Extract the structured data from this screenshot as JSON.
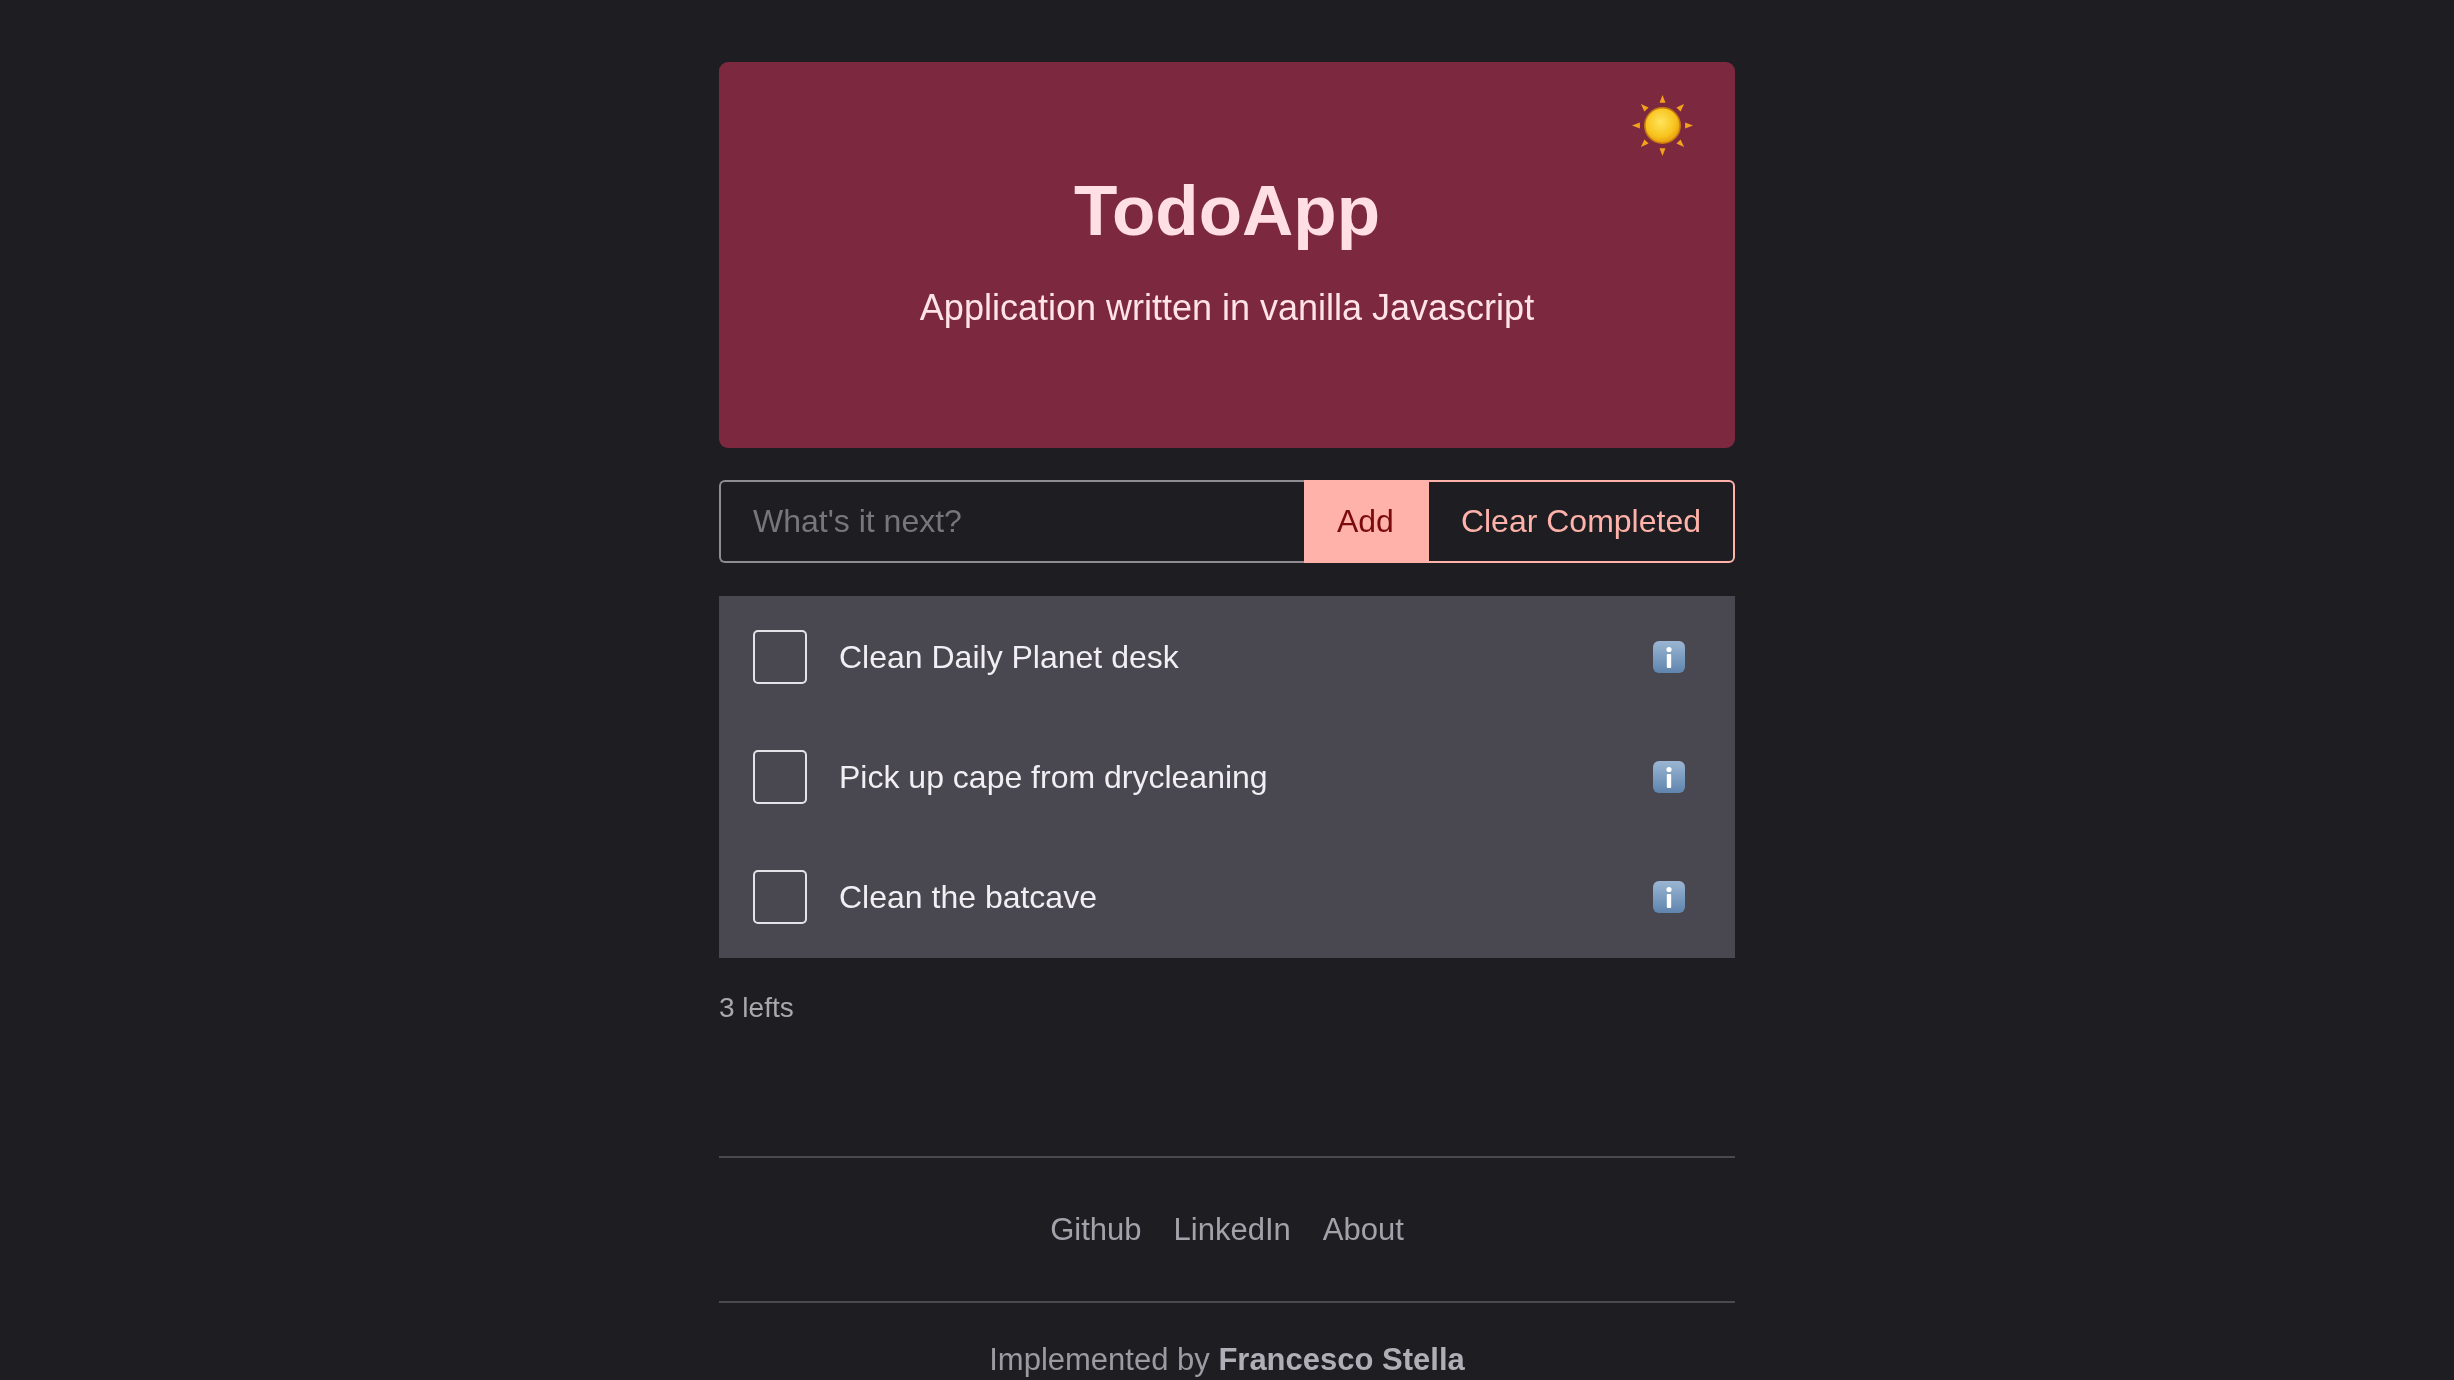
{
  "header": {
    "title": "TodoApp",
    "subtitle": "Application written in vanilla Javascript"
  },
  "new_todo": {
    "placeholder": "What's it next?"
  },
  "buttons": [
    {
      "label": "Add",
      "kind": "primary"
    },
    {
      "label": "Clear Completed",
      "kind": "outline"
    }
  ],
  "todos": [
    {
      "text": "Clean Daily Planet desk",
      "checked": false
    },
    {
      "text": "Pick up cape from drycleaning",
      "checked": false
    },
    {
      "text": "Clean the batcave",
      "checked": false
    }
  ],
  "remaining": "3 lefts",
  "footer": {
    "links": [
      "Github",
      "LinkedIn",
      "About"
    ],
    "credit": "Implemented by **Francesco Stella**"
  }
}
